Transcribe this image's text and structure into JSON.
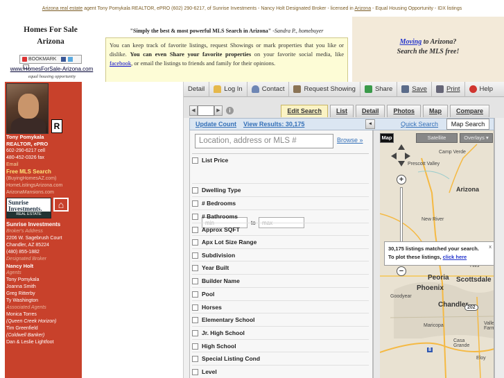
{
  "topbar": {
    "pre": "Arizona real estate",
    "main": " agent Tony Pomykala REALTOR, ePRO (602) 290-6217, of Sunrise Investments - Nancy Holt Designated Broker - licensed in ",
    "state_link": "Arizona",
    "post": " - Equal Housing Opportunity - IDX listings"
  },
  "header": {
    "title_line1": "Homes For Sale",
    "title_line2": "Arizona",
    "bookmark_label": "BOOKMARK",
    "site_url": "www.HomesForSale-Arizona.com",
    "equal_housing": "equal housing opportunity",
    "quote": "\"Simply the best & most powerful MLS Search in Arizona\"",
    "quote_author": " -Sandra P., homebuyer",
    "promo_1": "You can keep track of favorite listings, request Showings or mark properties that you like or dislike. ",
    "promo_bold": "You can even Share your favorite properties",
    "promo_2": " on your favorite social media, like ",
    "promo_link": "facebook",
    "promo_3": ", or email the listings to friends and family for their opinions.",
    "moving_link": "Moving",
    "moving_rest": " to Arizona?",
    "moving_line2": "Search the MLS free!"
  },
  "agent": {
    "name": "Tony Pomykala",
    "title": "REALTOR, ePRO",
    "cell": "602-290-6217 cell",
    "fax": "480-452-0326 fax",
    "email": "Email",
    "free_mls": "Free MLS Search",
    "site1": "(BuyingHomesAZ.com)",
    "site2": "HomeListingsArizona.com",
    "site3": "ArizonaMansions.com",
    "sunrise_logo_line1": "Sunrise",
    "sunrise_logo_line2": "Investments.",
    "sunrise_logo_line3": "REAL ESTATE",
    "brokerage": "Sunrise Investments",
    "brokers_address_label": "Broker's Address",
    "address1": "2206 W. Sagebrush Court",
    "address2": "Chandler, AZ 85224",
    "phone": "(480) 855-1882",
    "designated_broker_label": "Designated Broker",
    "broker_name": "Nancy Holt",
    "agents_label": "Agents",
    "agents": [
      "Tony Pomykala",
      "Joanna Smith",
      "Greg Ritterby",
      "Ty Washington"
    ],
    "associated_label": "Associated Agents",
    "associated": [
      "Monica Torres",
      "(Queen Creek Horizon)",
      "Tim Greenfield",
      "(Coldwell Banker)",
      "Dan & Leslie Lightfoot"
    ]
  },
  "toolbar": {
    "detail": "Detail",
    "login": "Log In",
    "contact": "Contact",
    "request": "Request Showing",
    "share": "Share",
    "save": "Save",
    "print": "Print",
    "help": "Help"
  },
  "tabs": [
    "Edit Search",
    "List",
    "Detail",
    "Photos",
    "Map",
    "Compare"
  ],
  "subbar": {
    "update_count": "Update Count",
    "view_results": "View Results: 30,175",
    "collapse": "◂",
    "quick_search": "Quick Search",
    "map_search": "Map Search"
  },
  "search": {
    "location_placeholder": "Location, address or MLS #",
    "browse": "Browse »",
    "list_price": "List Price",
    "min_placeholder": "min",
    "to": "to",
    "max_placeholder": "max",
    "filters": [
      "Dwelling Type",
      "# Bedrooms",
      "# Bathrooms",
      "Approx SQFT",
      "Apx Lot Size Range",
      "Subdivision",
      "Year Built",
      "Builder Name",
      "Pool",
      "Horses",
      "Elementary School",
      "Jr. High School",
      "High School",
      "Special Listing Cond",
      "Level"
    ]
  },
  "map": {
    "type_map": "Map",
    "type_satellite": "Satellite",
    "type_overlays": "Overlays ▾",
    "popup_line1": "30,175 listings matched your search.",
    "popup_line2_pre": "To plot these listings, ",
    "popup_link": "click here",
    "popup_close": "x",
    "labels": {
      "arizona": "Arizona",
      "phoenix": "Phoenix",
      "chandler": "Chandler",
      "scottsdale": "Scottsdale",
      "peoria": "Peoria",
      "prescott": "Prescott",
      "prescott_valley": "Prescott Valley",
      "camp_verde": "Camp Verde",
      "new_river": "New River",
      "fountain_hills": "Fountain Hills",
      "goodyear": "Goodyear",
      "maricopa": "Maricopa",
      "casa_grande": "Casa Grande",
      "eloy": "Eloy",
      "valley_farms": "Valley Farms",
      "highway_202": "202",
      "highway_8": "8"
    }
  },
  "colors": {
    "sidebar": "#c8412b",
    "moving_bg": "#f3ead9",
    "promo_bg": "#fdfcd6",
    "link_blue": "#3470b8"
  }
}
